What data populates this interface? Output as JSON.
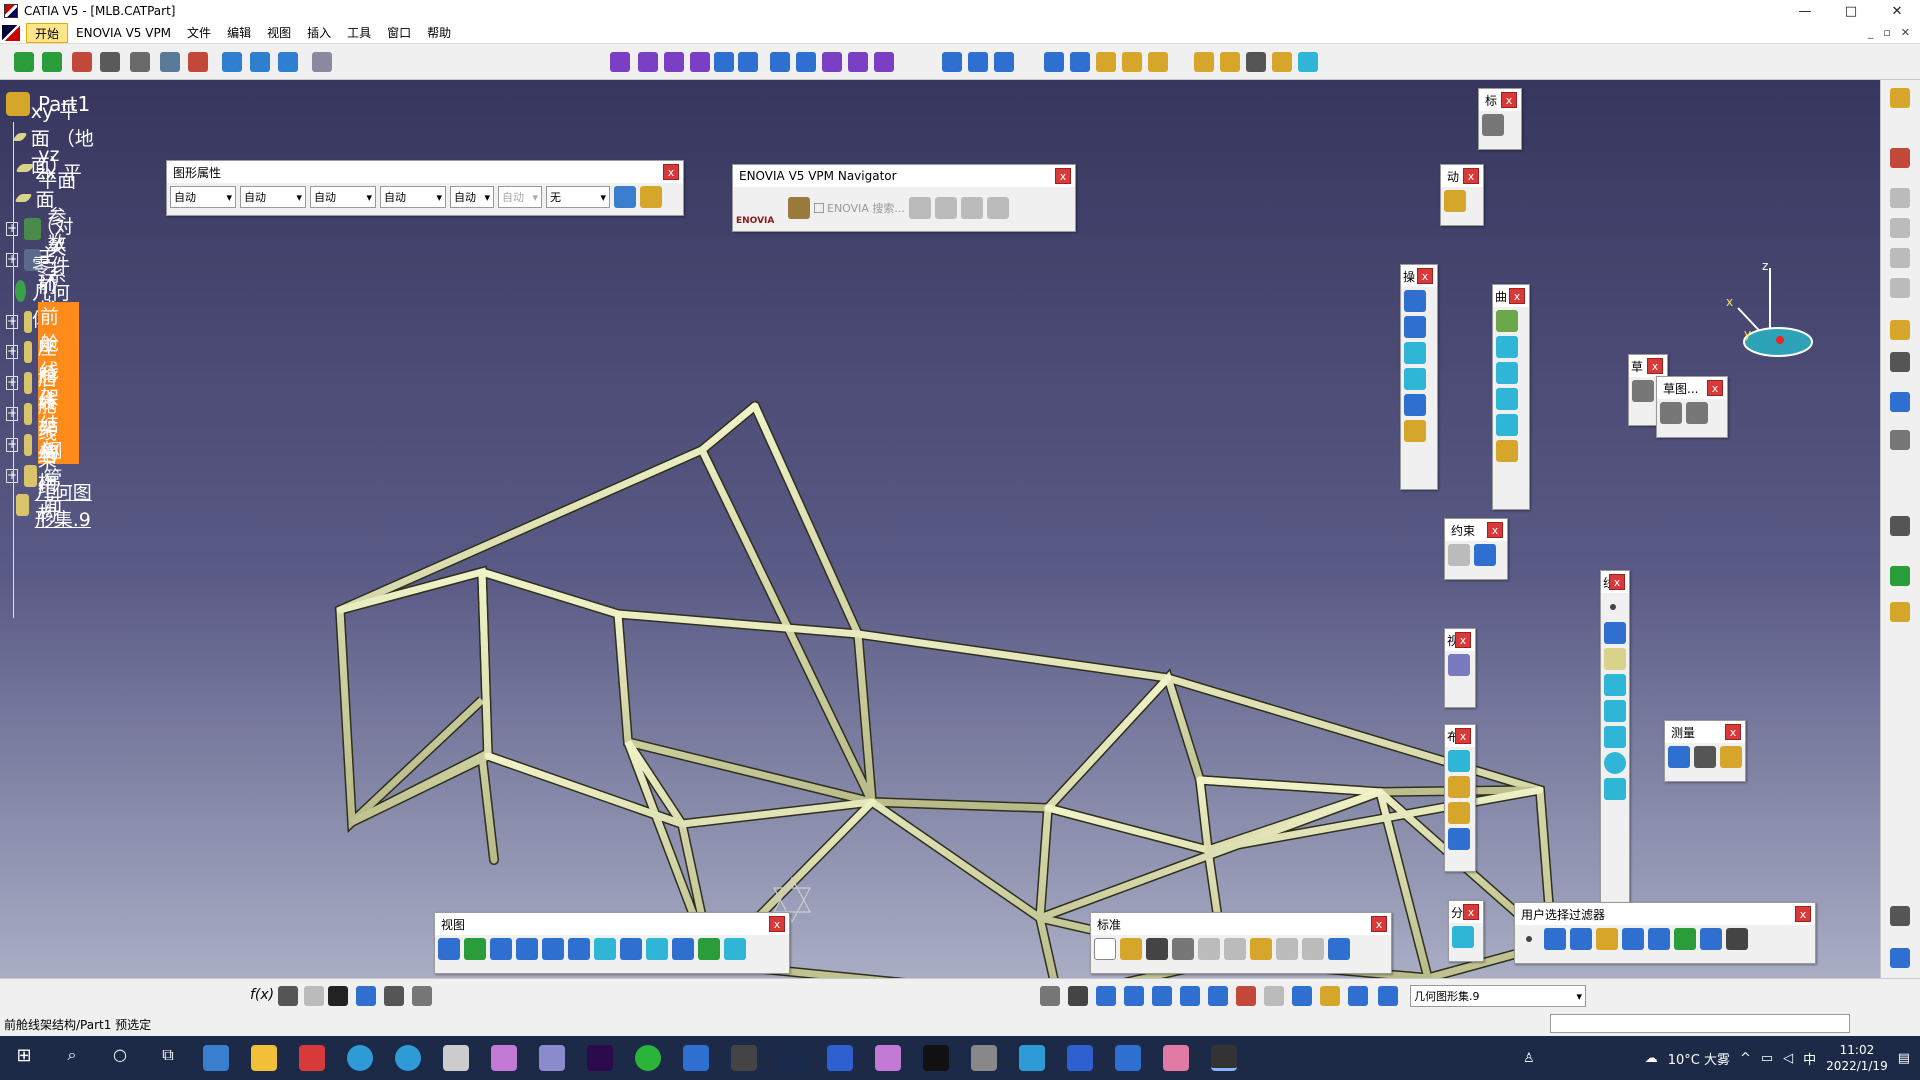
{
  "window": {
    "title": "CATIA V5 - [MLB.CATPart]",
    "minimize": "—",
    "maximize": "□",
    "close": "✕"
  },
  "menu": [
    "开始",
    "ENOVIA V5 VPM",
    "文件",
    "编辑",
    "视图",
    "插入",
    "工具",
    "窗口",
    "帮助"
  ],
  "tree": {
    "root": "Part1",
    "items": [
      {
        "label": "xy 平面 （地面）",
        "icon": "plane-icon",
        "expandable": false
      },
      {
        "label": "yz 平面",
        "icon": "plane-icon",
        "expandable": false
      },
      {
        "label": "zx 平面 （对",
        "icon": "plane-icon",
        "expandable": false
      },
      {
        "label": "参数",
        "icon": "parameters-icon",
        "expandable": true
      },
      {
        "label": "关系",
        "icon": "relations-icon",
        "expandable": true
      },
      {
        "label": "零件几何体",
        "icon": "part-body-icon",
        "expandable": false
      },
      {
        "label": "主环线架结构",
        "icon": "geometrical-set-icon",
        "expandable": true
      },
      {
        "label": "前环线架结构",
        "icon": "geometrical-set-icon",
        "expandable": true
      },
      {
        "label": "前舱线架结构",
        "icon": "geometrical-set-icon",
        "expandable": true,
        "selected": true
      },
      {
        "label": "座舱线架结构",
        "icon": "geometrical-set-icon",
        "expandable": true
      },
      {
        "label": "后舱线架结构",
        "icon": "geometrical-set-icon",
        "expandable": true
      },
      {
        "label": "钢管面",
        "icon": "geometrical-set-icon",
        "expandable": true
      },
      {
        "label": "几何图形集.9",
        "icon": "geometrical-set-icon",
        "expandable": false,
        "underlined": true
      }
    ]
  },
  "palettes": {
    "graphic_properties": {
      "title": "图形属性",
      "combos": [
        "自动",
        "自动",
        "自动",
        "自动",
        "自动",
        "自动",
        "无"
      ]
    },
    "enovia_nav": {
      "title": "ENOVIA V5 VPM Navigator",
      "checkbox_label": "ENOVIA 搜索...",
      "logo_text": "ENOVIA"
    },
    "small_1": {
      "title": "标"
    },
    "small_2": {
      "title": "动"
    },
    "small_3": {
      "title": "操"
    },
    "small_4": {
      "title": "曲"
    },
    "small_5": {
      "title": "草"
    },
    "sketch": {
      "title": "草图..."
    },
    "constraint": {
      "title": "约束"
    },
    "small_6": {
      "title": "线"
    },
    "small_7": {
      "title": "视"
    },
    "small_8": {
      "title": "布"
    },
    "measure": {
      "title": "测量"
    },
    "small_9": {
      "title": "分"
    },
    "view": {
      "title": "视图"
    },
    "standard": {
      "title": "标准"
    },
    "user_filter": {
      "title": "用户选择过滤器"
    }
  },
  "bottom": {
    "current_set": "几何图形集.9",
    "formula_label": "f(x)"
  },
  "status": {
    "text": "前舱线架结构/Part1 预选定"
  },
  "taskbar": {
    "weather": "10°C 大雾",
    "ime": "中",
    "time": "11:02",
    "date": "2022/1/19"
  },
  "colors": {
    "tube": "#d9dcae",
    "selected": "#ff8c1a",
    "close": "#d83a3a"
  }
}
